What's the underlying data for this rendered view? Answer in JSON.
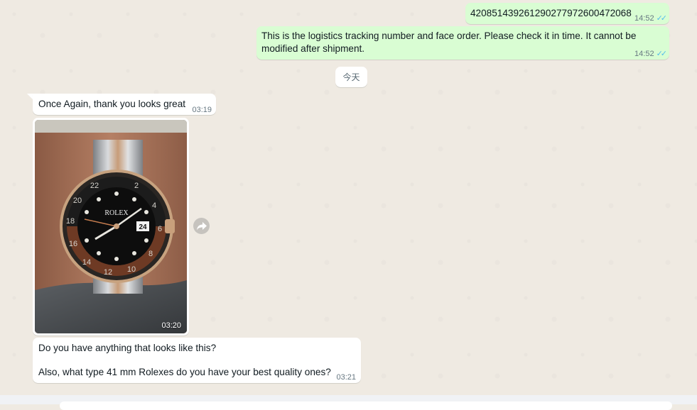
{
  "messages": [
    {
      "direction": "outgoing",
      "text": "420851439261290277972600472068",
      "time": "14:52",
      "status_icon": "double-check-read-icon"
    },
    {
      "direction": "outgoing",
      "text": "This is the logistics tracking number and face order. Please check it in time. It cannot be modified after shipment.",
      "time": "14:52",
      "status_icon": "double-check-read-icon"
    },
    {
      "direction": "incoming",
      "text": "Once Again, thank you looks great",
      "time": "03:19"
    },
    {
      "direction": "incoming",
      "type": "image",
      "image_subject": "wrist-watch-photo",
      "time": "03:20"
    },
    {
      "direction": "incoming",
      "text_line1": "Do you have anything that looks like this?",
      "text_line2": "Also, what type 41 mm Rolexes do you have your best quality ones?",
      "time": "03:21"
    }
  ],
  "date_divider": "今天",
  "watch_dial": {
    "brand": "ROLEX",
    "date": "24",
    "bezel_numbers": [
      "22",
      "2",
      "4",
      "6",
      "8",
      "10",
      "12",
      "14",
      "16",
      "18",
      "20"
    ]
  },
  "icons": {
    "read_receipt": "✓✓",
    "forward": "forward-arrow-icon"
  },
  "colors": {
    "chat_background": "#efeae2",
    "outgoing_bubble": "#d9fdd3",
    "incoming_bubble": "#ffffff",
    "read_tick": "#53bdeb",
    "meta_text": "#667781"
  }
}
